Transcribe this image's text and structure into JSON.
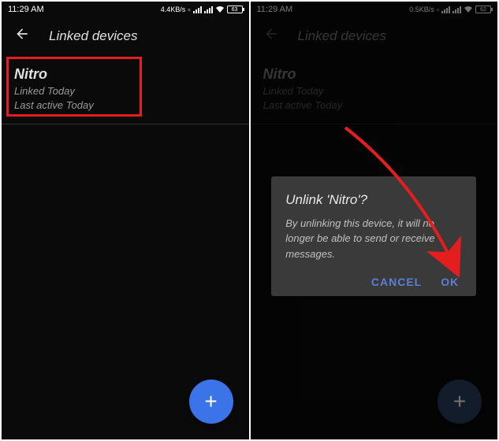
{
  "left": {
    "status": {
      "time": "11:29 AM",
      "speed": "4.4KB/s",
      "battery": "63"
    },
    "appbar": {
      "title": "Linked devices"
    },
    "device": {
      "name": "Nitro",
      "linked": "Linked Today",
      "active": "Last active Today"
    }
  },
  "right": {
    "status": {
      "time": "11:29 AM",
      "speed": "0.5KB/s",
      "battery": "62"
    },
    "appbar": {
      "title": "Linked devices"
    },
    "device": {
      "name": "Nitro",
      "linked": "Linked Today",
      "active": "Last active Today"
    },
    "dialog": {
      "title": "Unlink 'Nitro'?",
      "body": "By unlinking this device, it will no longer be able to send or receive messages.",
      "cancel": "CANCEL",
      "ok": "OK"
    }
  }
}
